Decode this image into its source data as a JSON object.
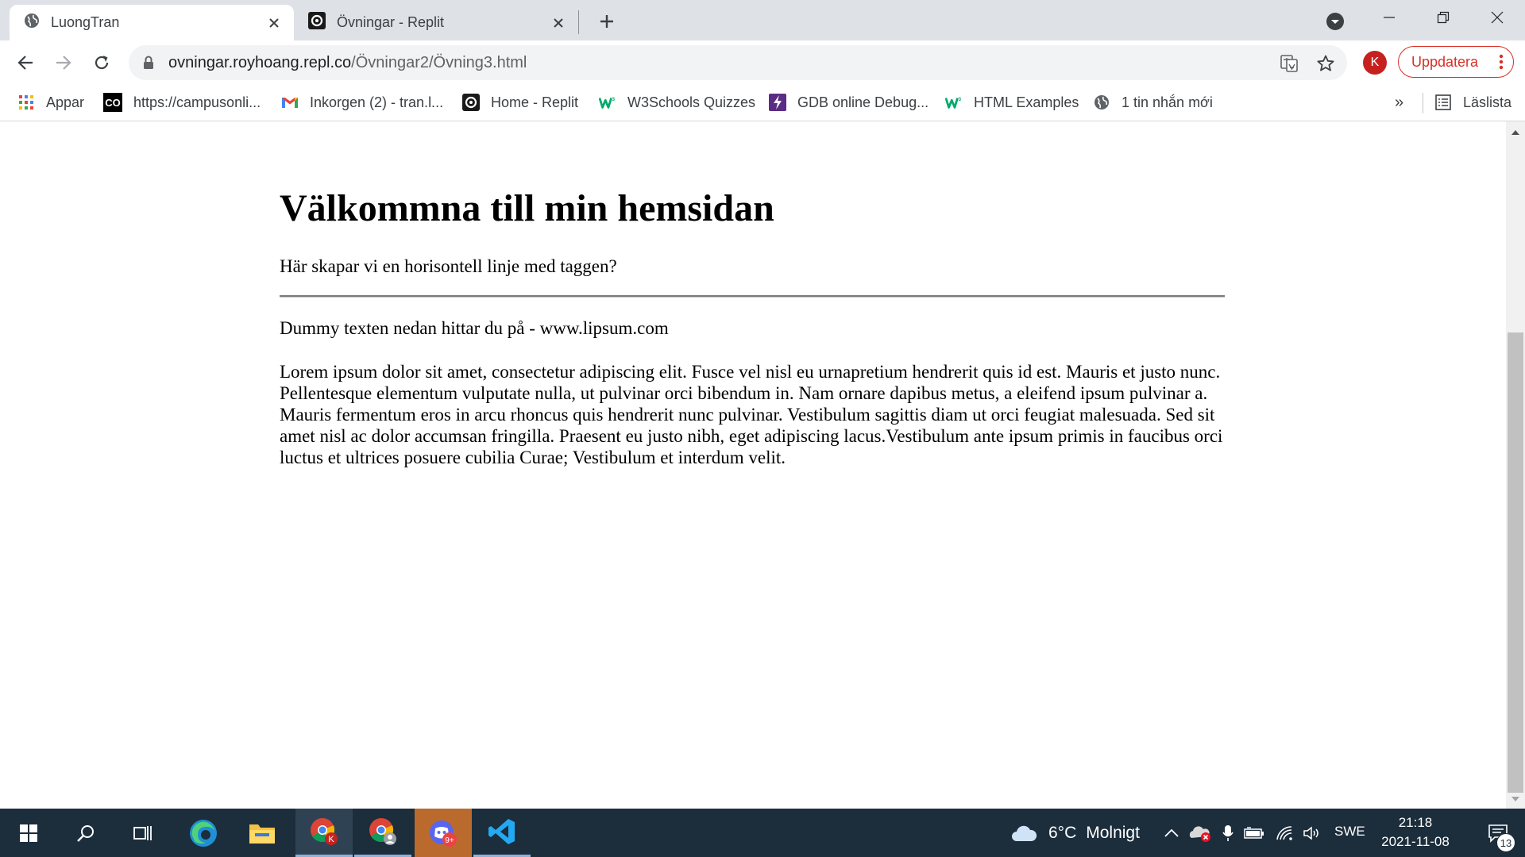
{
  "browser": {
    "tabs": [
      {
        "title": "LuongTran",
        "icon": "globe-icon",
        "active": true
      },
      {
        "title": "Övningar - Replit",
        "icon": "replit-icon",
        "active": false
      }
    ],
    "address": {
      "host": "ovningar.royhoang.repl.co",
      "path": "/Övningar2/Övning3.html"
    },
    "profile_initial": "K",
    "update_label": "Uppdatera",
    "accent": "#d93025"
  },
  "bookmarks": {
    "items": [
      {
        "label": "Appar",
        "icon": "apps-grid-icon"
      },
      {
        "label": "https://campusonli...",
        "icon": "co-icon",
        "icon_text": "CO"
      },
      {
        "label": "Inkorgen (2) - tran.l...",
        "icon": "gmail-icon"
      },
      {
        "label": "Home - Replit",
        "icon": "replit-icon"
      },
      {
        "label": "W3Schools Quizzes",
        "icon": "w3schools-icon"
      },
      {
        "label": "GDB online Debug...",
        "icon": "gdb-icon"
      },
      {
        "label": "HTML Examples",
        "icon": "w3schools-icon"
      },
      {
        "label": "1 tin nhắn mới",
        "icon": "globe-icon"
      }
    ],
    "more_label": "»",
    "reading_list_label": "Läslista"
  },
  "page": {
    "heading": "Välkommna till min hemsidan",
    "intro": "Här skapar vi en horisontell linje med taggen?",
    "dummy_note": "Dummy texten nedan hittar du på - www.lipsum.com",
    "lorem": "Lorem ipsum dolor sit amet, consectetur adipiscing elit. Fusce vel nisl eu urnapretium hendrerit quis id est. Mauris et justo nunc. Pellentesque elementum vulputate nulla, ut pulvinar orci bibendum in. Nam ornare dapibus metus, a eleifend ipsum pulvinar a. Mauris fermentum eros in arcu rhoncus quis hendrerit nunc pulvinar. Vestibulum sagittis diam ut orci feugiat malesuada. Sed sit amet nisl ac dolor accumsan fringilla. Praesent eu justo nibh, eget adipiscing lacus.Vestibulum ante ipsum primis in faucibus orci luctus et ultrices posuere cubilia Curae; Vestibulum et interdum velit."
  },
  "taskbar": {
    "weather": {
      "temp": "6°C",
      "condition": "Molnigt"
    },
    "language": "SWE",
    "time": "21:18",
    "date": "2021-11-08",
    "chrome_badge": "K",
    "discord_badge": "9+",
    "notification_count": "13"
  }
}
